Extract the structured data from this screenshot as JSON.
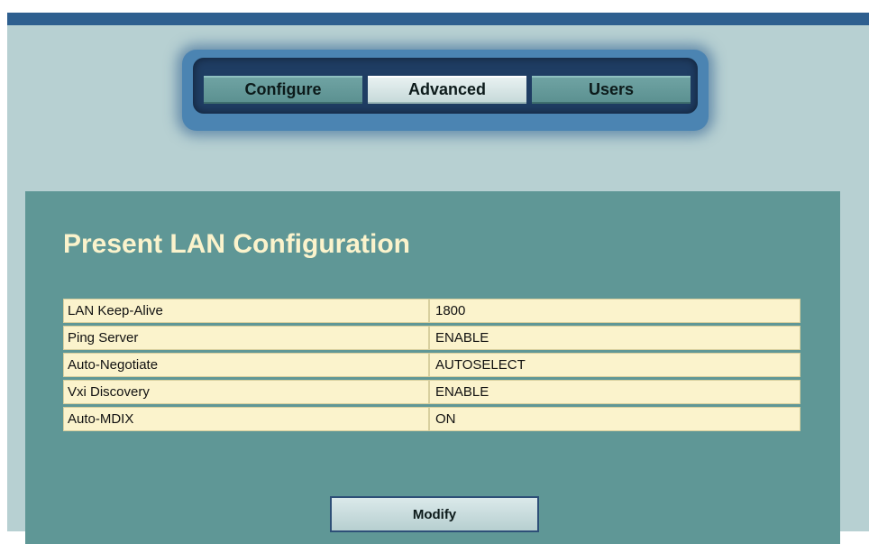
{
  "tabs": [
    {
      "label": "Configure",
      "active": false
    },
    {
      "label": "Advanced",
      "active": true
    },
    {
      "label": "Users",
      "active": false
    }
  ],
  "panel": {
    "title": "Present LAN Configuration",
    "rows": [
      {
        "label": "LAN Keep-Alive",
        "value": "1800"
      },
      {
        "label": "Ping Server",
        "value": "ENABLE"
      },
      {
        "label": "Auto-Negotiate",
        "value": "AUTOSELECT"
      },
      {
        "label": "Vxi Discovery",
        "value": "ENABLE"
      },
      {
        "label": "Auto-MDIX",
        "value": "ON"
      }
    ],
    "modify_label": "Modify"
  },
  "colors": {
    "top_bar": "#2e5f8f",
    "background": "#b7d0d2",
    "panel": "#5f9796",
    "title_text": "#fbf3cc",
    "cell": "#fbf3cc"
  }
}
